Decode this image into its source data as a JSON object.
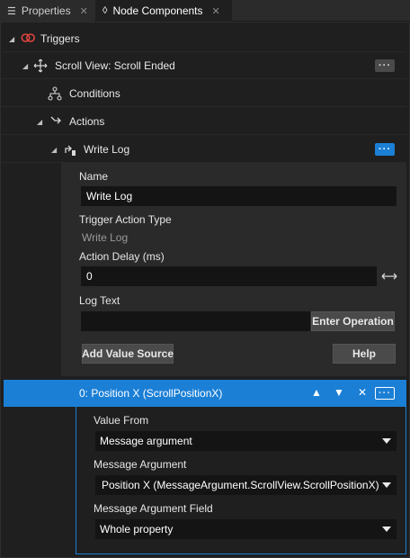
{
  "tabs": [
    {
      "label": "Properties",
      "icon": "list-icon"
    },
    {
      "label": "Node Components",
      "icon": "node-components-icon"
    }
  ],
  "tree": {
    "triggers": "Triggers",
    "trigger_item": "Scroll View: Scroll Ended",
    "conditions": "Conditions",
    "actions": "Actions",
    "action_item": "Write Log"
  },
  "write_log": {
    "name_label": "Name",
    "name_value": "Write Log",
    "type_label": "Trigger Action Type",
    "type_value": "Write Log",
    "delay_label": "Action Delay (ms)",
    "delay_value": "0",
    "log_text_label": "Log Text",
    "log_text_value": "",
    "enter_operation": "Enter Operation",
    "add_value_source": "Add Value Source",
    "help": "Help"
  },
  "value_source": {
    "title": "0: Position X (ScrollPositionX)",
    "value_from_label": "Value From",
    "value_from": "Message argument",
    "message_argument_label": "Message Argument",
    "message_argument": "Position X (MessageArgument.ScrollView.ScrollPositionX)",
    "message_argument_field_label": "Message Argument Field",
    "message_argument_field": "Whole property"
  },
  "colors": {
    "accent": "#1b7fd6",
    "trigger_icon": "#e0443e",
    "background": "#1f1f1f"
  }
}
